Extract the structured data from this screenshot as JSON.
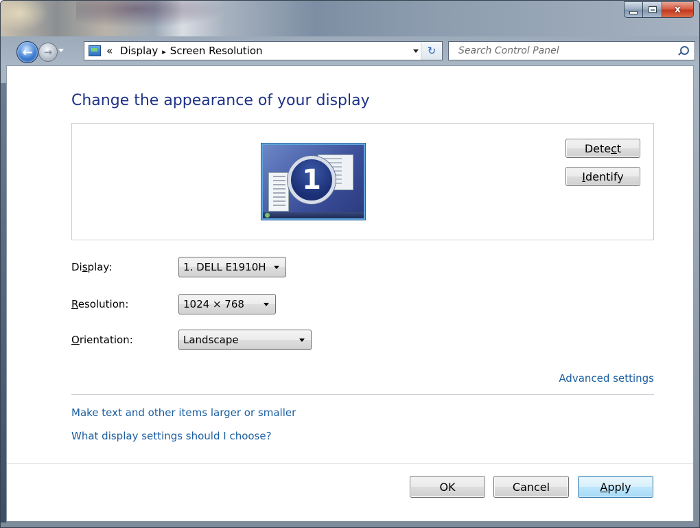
{
  "window": {
    "caption_buttons": {
      "minimize": "",
      "maximize": "",
      "close": "x"
    },
    "colors": {
      "title_link": "#1e3287",
      "link": "#1a5ea0",
      "frame": "#36424f"
    }
  },
  "navigation": {
    "back_icon": "back-arrow-icon",
    "forward_icon": "forward-arrow-icon",
    "address": {
      "overflow": "«",
      "crumb1": "Display",
      "separator": "▸",
      "crumb2": "Screen Resolution"
    },
    "refresh_glyph": "↻",
    "search": {
      "placeholder": "Search Control Panel"
    }
  },
  "main": {
    "title": "Change the appearance of your display",
    "monitor": {
      "number": "1"
    },
    "buttons": {
      "detect_pre": "Dete",
      "detect_ul": "c",
      "detect_post": "t",
      "identify_ul": "I",
      "identify_post": "dentify"
    },
    "settings": {
      "display": {
        "label_pre": "Di",
        "label_ul": "s",
        "label_post": "play:",
        "value": "1. DELL E1910H"
      },
      "resolution": {
        "label_ul": "R",
        "label_post": "esolution:",
        "value": "1024 × 768"
      },
      "orientation": {
        "label_ul": "O",
        "label_post": "rientation:",
        "value": "Landscape"
      }
    },
    "advanced_link": "Advanced settings",
    "links": [
      "Make text and other items larger or smaller",
      "What display settings should I choose?"
    ]
  },
  "footer": {
    "ok": "OK",
    "cancel": "Cancel",
    "apply_ul": "A",
    "apply_post": "pply"
  }
}
